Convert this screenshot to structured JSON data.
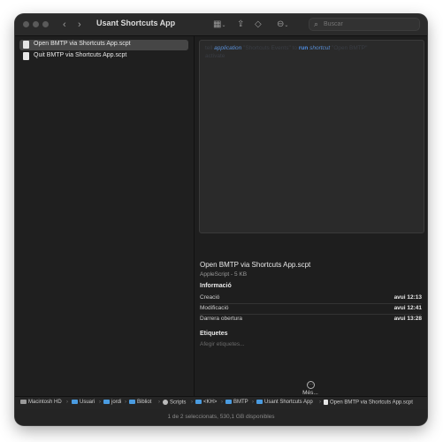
{
  "window": {
    "title": "Usant Shortcuts App"
  },
  "toolbar": {
    "back_icon": "chevron-left-icon",
    "forward_icon": "chevron-right-icon",
    "view_icon": "grid-icon",
    "share_icon": "share-icon",
    "tag_icon": "tag-icon",
    "action_icon": "ellipsis-circle-icon",
    "search_placeholder": "Buscar"
  },
  "files": [
    {
      "name": "Open BMTP via Shortcuts App.scpt",
      "selected": true
    },
    {
      "name": "Quit BMTP via Shortcuts App.scpt",
      "selected": false
    }
  ],
  "preview": {
    "line1_pre": "tell",
    "line1_app": "application",
    "line1_mid": "\"Shortcuts Events\" to",
    "line1_run": "run",
    "line1_shortcut": "shortcut",
    "line1_post": "\"Open BMTP\"",
    "line2": "activate"
  },
  "details": {
    "filename": "Open BMTP via Shortcuts App.scpt",
    "meta": "AppleScript - 5 KB",
    "info_heading": "Informació",
    "info_rows": [
      {
        "label": "Creació",
        "value": "avui 12:13"
      },
      {
        "label": "Modificació",
        "value": "avui 12:41"
      },
      {
        "label": "Darrera obertura",
        "value": "avui 13:28"
      }
    ],
    "tags_heading": "Etiquetes",
    "tags_placeholder": "Afegir etiquetes...",
    "more_label": "Més..."
  },
  "pathbar": [
    "Macintosh HD",
    "Usuari",
    "jordi",
    "Bibliot",
    "Scripts",
    "<KH>",
    "BMTP",
    "Usant Shortcuts App",
    "Open BMTP via Shortcuts App.scpt"
  ],
  "status": "1 de 2 seleccionats, 530,1 GB disponibles",
  "colors": {
    "selection": "#464646",
    "accent": "#4f8ce0",
    "folder": "#4a9be0"
  }
}
